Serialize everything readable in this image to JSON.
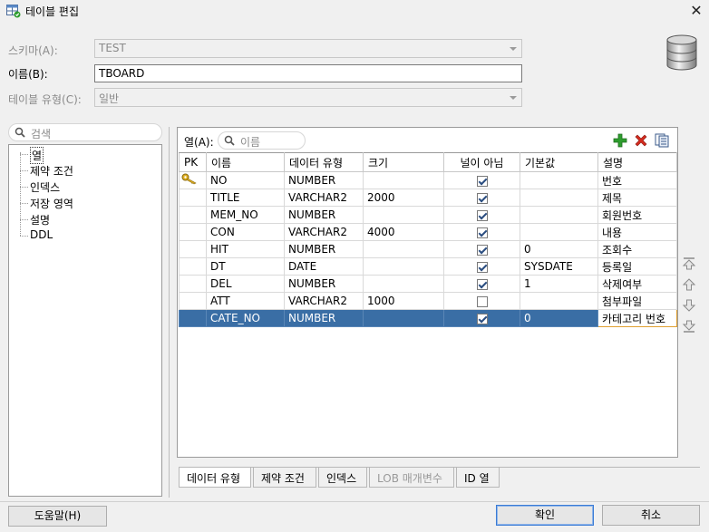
{
  "window": {
    "title": "테이블 편집",
    "close_glyph": "✕"
  },
  "form": {
    "schema_label": "스키마(A):",
    "schema_value": "TEST",
    "name_label": "이름(B):",
    "name_value": "TBOARD",
    "table_type_label": "테이블 유형(C):",
    "table_type_value": "일반"
  },
  "left_panel": {
    "search_placeholder": "검색",
    "tree_items": [
      "열",
      "제약 조건",
      "인덱스",
      "저장 영역",
      "설명",
      "DDL"
    ]
  },
  "columns_panel": {
    "filter_label": "열(A):",
    "filter_placeholder": "이름",
    "headers": [
      "PK",
      "이름",
      "데이터 유형",
      "크기",
      "널이 아님",
      "기본값",
      "설명"
    ],
    "rows": [
      {
        "pk": true,
        "name": "NO",
        "type": "NUMBER",
        "size": "",
        "not_null": true,
        "default": "",
        "comment": "번호"
      },
      {
        "pk": false,
        "name": "TITLE",
        "type": "VARCHAR2",
        "size": "2000",
        "not_null": true,
        "default": "",
        "comment": "제목"
      },
      {
        "pk": false,
        "name": "MEM_NO",
        "type": "NUMBER",
        "size": "",
        "not_null": true,
        "default": "",
        "comment": "회원번호"
      },
      {
        "pk": false,
        "name": "CON",
        "type": "VARCHAR2",
        "size": "4000",
        "not_null": true,
        "default": "",
        "comment": "내용"
      },
      {
        "pk": false,
        "name": "HIT",
        "type": "NUMBER",
        "size": "",
        "not_null": true,
        "default": "0",
        "comment": "조회수"
      },
      {
        "pk": false,
        "name": "DT",
        "type": "DATE",
        "size": "",
        "not_null": true,
        "default": "SYSDATE",
        "comment": "등록일"
      },
      {
        "pk": false,
        "name": "DEL",
        "type": "NUMBER",
        "size": "",
        "not_null": true,
        "default": "1",
        "comment": "삭제여부"
      },
      {
        "pk": false,
        "name": "ATT",
        "type": "VARCHAR2",
        "size": "1000",
        "not_null": false,
        "default": "",
        "comment": "첨부파일"
      },
      {
        "pk": false,
        "name": "CATE_NO",
        "type": "NUMBER",
        "size": "",
        "not_null": true,
        "default": "0",
        "comment": "카테고리 번호",
        "selected": true
      }
    ]
  },
  "bottom_tabs": [
    {
      "label": "데이터 유형",
      "disabled": false
    },
    {
      "label": "제약 조건",
      "disabled": false
    },
    {
      "label": "인덱스",
      "disabled": false
    },
    {
      "label": "LOB 매개변수",
      "disabled": true
    },
    {
      "label": "ID 열",
      "disabled": false
    }
  ],
  "buttons": {
    "help": "도움말(H)",
    "ok": "확인",
    "cancel": "취소"
  },
  "colors": {
    "selection": "#3a6ea5",
    "add_icon": "#2e9d2e",
    "delete_icon": "#d42a1e"
  }
}
